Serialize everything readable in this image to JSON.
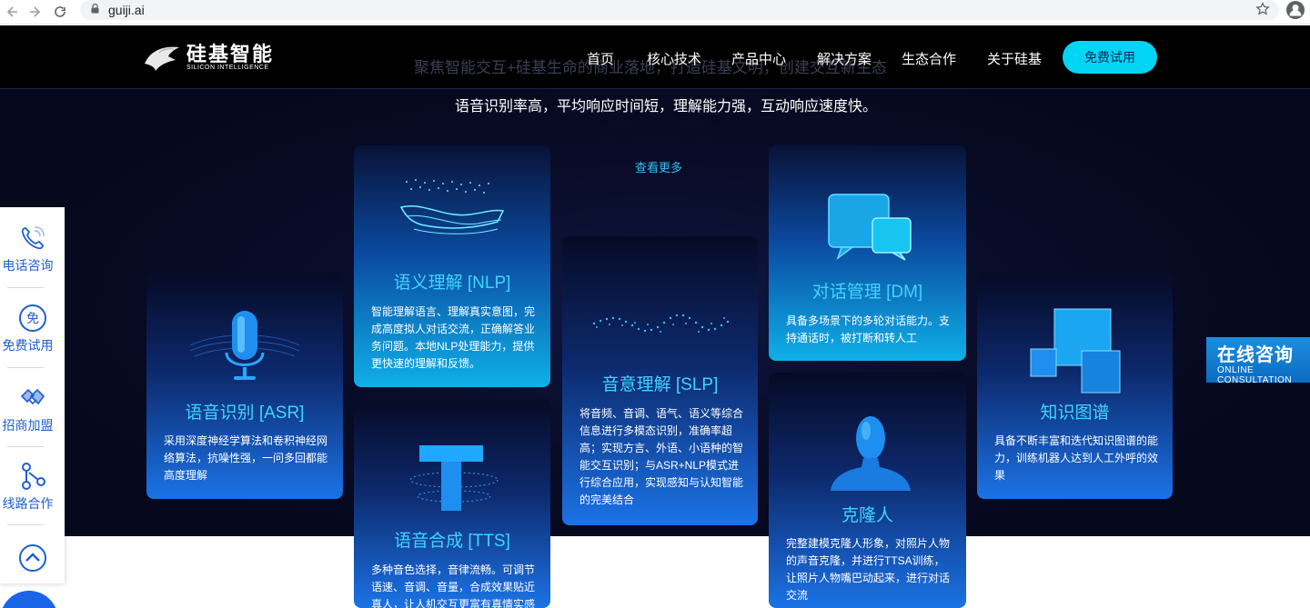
{
  "browser": {
    "url": "guiji.ai",
    "back_icon": "arrow-left-icon",
    "forward_icon": "arrow-right-icon",
    "reload_icon": "reload-icon"
  },
  "header": {
    "logo_cn": "硅基智能",
    "logo_en": "SILICON INTELLIGENCE",
    "ghost_title": "聚焦智能交互+硅基生命的商业落地，打造硅基文明，创建交互新生态",
    "nav": [
      "首页",
      "核心技术",
      "产品中心",
      "解决方案",
      "生态合作",
      "关于硅基"
    ],
    "trial_button": "免费试用"
  },
  "hero": {
    "subtitle": "语音识别率高，平均响应时间短，理解能力强，互动响应速度快。",
    "see_more": "查看更多"
  },
  "cards": {
    "asr": {
      "title": "语音识别 [ASR]",
      "desc": "采用深度神经学算法和卷积神经网络算法，抗噪性强，一问多回都能高度理解"
    },
    "nlp": {
      "title": "语义理解 [NLP]",
      "desc": "智能理解语言、理解真实意图，完成高度拟人对话交流，正确解答业务问题。本地NLP处理能力，提供更快速的理解和反馈。"
    },
    "tts": {
      "title": "语音合成 [TTS]",
      "desc": "多种音色选择，音律流畅。可调节语速、音调、音量，合成效果贴近真人，让人机交互更富有真情实感"
    },
    "slp": {
      "title": "音意理解 [SLP]",
      "desc": "将音频、音调、语气、语义等综合信息进行多模态识别，准确率超高；实现方言、外语、小语种的智能交互识别；与ASR+NLP模式进行综合应用，实现感知与认知智能的完美结合"
    },
    "dm": {
      "title": "对话管理 [DM]",
      "desc": "具备多场景下的多轮对话能力。支持通话时，被打断和转人工"
    },
    "clone": {
      "title": "克隆人",
      "desc": "完整建模克隆人形象，对照片人物的声音克隆，并进行TTSA训练，让照片人物嘴巴动起来，进行对话交流"
    },
    "kg": {
      "title": "知识图谱",
      "desc": "具备不断丰富和迭代知识图谱的能力，训练机器人达到人工外呼的效果"
    }
  },
  "sidebar": {
    "items": [
      {
        "label": "电话咨询",
        "icon": "phone-icon"
      },
      {
        "label": "免费试用",
        "icon": "free-trial-icon"
      },
      {
        "label": "招商加盟",
        "icon": "handshake-icon"
      },
      {
        "label": "线路合作",
        "icon": "network-icon"
      }
    ],
    "top_icon": "chevron-up-icon"
  },
  "online": {
    "cn": "在线咨询",
    "en": "ONLINE CONSULTATION"
  },
  "colors": {
    "accent": "#00d5f5",
    "hero_bg": "#06081d",
    "card_title": "#40d4ff",
    "sidebar_label": "#1e5fd1"
  }
}
